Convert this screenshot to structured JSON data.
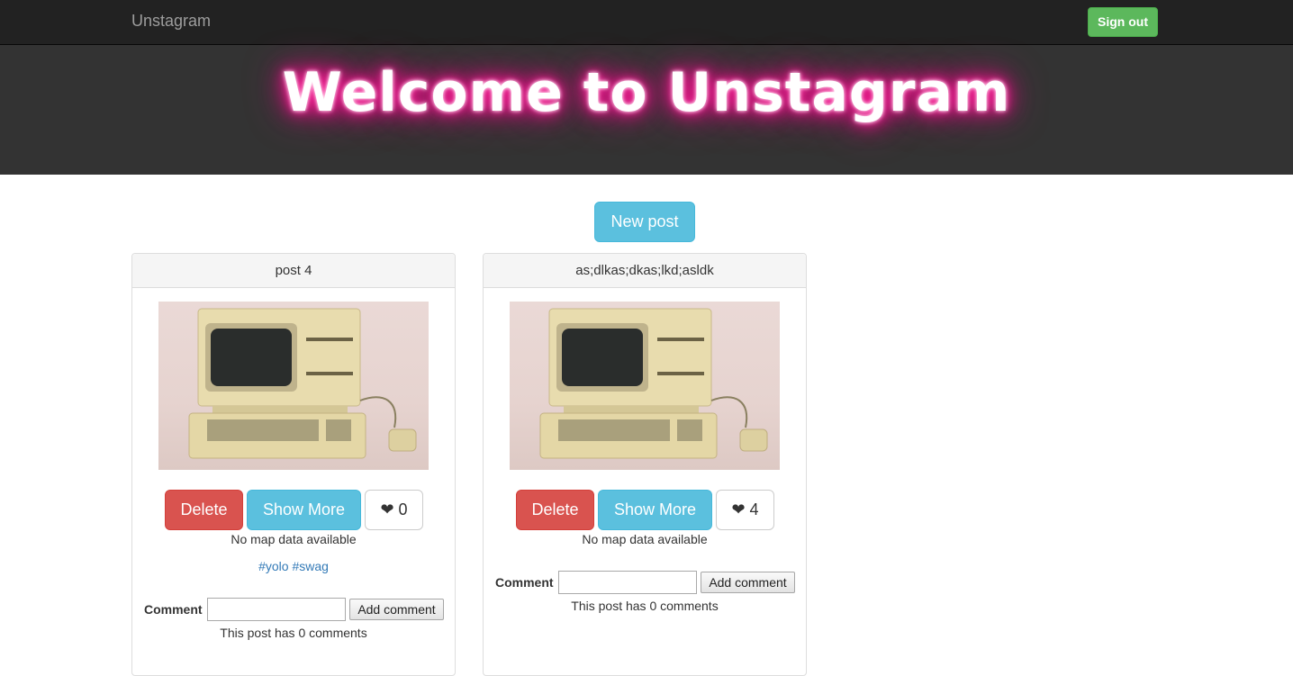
{
  "navbar": {
    "brand": "Unstagram",
    "signout_label": "Sign out"
  },
  "hero": {
    "title": "Welcome to Unstagram"
  },
  "actions": {
    "new_post_label": "New post"
  },
  "posts": [
    {
      "title": "post 4",
      "delete_label": "Delete",
      "show_more_label": "Show More",
      "like_icon": "❤",
      "likes": "0",
      "map_text": "No map data available",
      "tags": [
        "#yolo",
        "#swag"
      ],
      "comment_label": "Comment",
      "comment_value": "",
      "add_comment_label": "Add comment",
      "comment_count_text": "This post has 0 comments"
    },
    {
      "title": "as;dlkas;dkas;lkd;asldk",
      "delete_label": "Delete",
      "show_more_label": "Show More",
      "like_icon": "❤",
      "likes": "4",
      "map_text": "No map data available",
      "tags": [],
      "comment_label": "Comment",
      "comment_value": "",
      "add_comment_label": "Add comment",
      "comment_count_text": "This post has 0 comments"
    }
  ],
  "colors": {
    "navbar_bg": "#222222",
    "hero_bg": "#333333",
    "signout_green": "#5cb85c",
    "info_blue": "#5bc0de",
    "danger_red": "#d9534f",
    "link_blue": "#337ab7",
    "neon_pink": "#ff1493"
  }
}
